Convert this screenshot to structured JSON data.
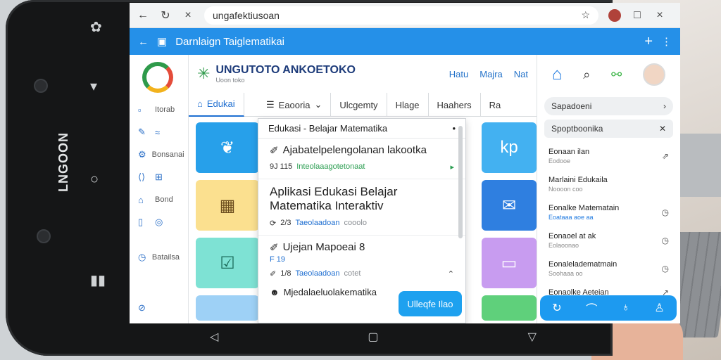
{
  "device": {
    "brand": "LNGOON",
    "side_icons": [
      "settings-icon",
      "message-icon",
      "home-circle-icon",
      "recents-icon"
    ],
    "nav_icons": [
      "back-triangle-icon",
      "home-square-icon",
      "down-chevron-icon"
    ]
  },
  "browser": {
    "url": "ungafektiusoan",
    "back": "←",
    "reload": "↻",
    "close_tab": "×",
    "window_minimize": "□",
    "window_close": "×"
  },
  "appbar": {
    "title": "Darnlaign Taiglematikai",
    "back": "←",
    "plus": "+",
    "more": "⋮"
  },
  "sidebar": {
    "items": [
      {
        "label": "Itorab",
        "icon": "square-icon"
      },
      {
        "label": "",
        "icon": "pencil-icon"
      },
      {
        "label": "Bonsanai",
        "icon": "gear-icon"
      },
      {
        "label": "",
        "icon": "code-icon"
      },
      {
        "label": "Bond",
        "icon": "tag-icon"
      },
      {
        "label": "",
        "icon": "doc-icon"
      },
      {
        "label": "Batailsa",
        "icon": "clock-icon"
      },
      {
        "label": "",
        "icon": "compass-icon"
      }
    ]
  },
  "header": {
    "brand": "UNGUTOTO ANKOETOKO",
    "subtitle": "Uoon toko",
    "links": [
      "Hatu",
      "Majra",
      "Nat"
    ]
  },
  "tabs": [
    {
      "label": "Edukai",
      "active": true
    },
    {
      "label": "Eaooria",
      "active": false
    },
    {
      "label": "Ulcgemty",
      "active": false
    },
    {
      "label": "Hlage",
      "active": false
    },
    {
      "label": "Haahers",
      "active": false
    },
    {
      "label": "Ra",
      "active": false
    }
  ],
  "dropdown": {
    "header": "Edukasi - Belajar Matematika",
    "items": [
      {
        "title": "Ajabatelpelengolanan lakootka",
        "meta_a": "9J 115",
        "meta_b": "Inteolaaagotetonaat",
        "meta_c": ""
      },
      {
        "title": "Aplikasi Edukasi Belajar Matematika Interaktiv",
        "meta_a": "2/3",
        "meta_b": "Taeolaadoan",
        "meta_c": "cooolo"
      },
      {
        "title": "Ujejan Mapoeai 8",
        "meta_a": "F 19",
        "meta_b": "",
        "meta_c": ""
      },
      {
        "title": "",
        "meta_a": "1/8",
        "meta_b": "Taeolaadoan",
        "meta_c": "cotet"
      },
      {
        "title": "Mjedalaeluolakematika",
        "meta_a": "",
        "meta_b": "",
        "meta_c": ""
      }
    ],
    "fab": "Ulleqfe Ilao"
  },
  "panel": {
    "pill1": "Sapadoeni",
    "pill2": "Spoptboonika",
    "items": [
      {
        "title": "Eonaan ilan",
        "sub": "Eodooe",
        "icon": "→"
      },
      {
        "title": "Marlaini Edukaila",
        "sub": "Noooon coo",
        "icon": ""
      },
      {
        "title": "Eonalke Matematain",
        "sub": "Eoataaa aoe aa",
        "icon": "○"
      },
      {
        "title": "Eonaoel at ak",
        "sub": "Eolaoonao",
        "icon": "○"
      },
      {
        "title": "Eonaleladematmain",
        "sub": "Soohaaa oo",
        "icon": "○"
      },
      {
        "title": "Eonaolke Aeteian",
        "sub": "",
        "icon": "↗"
      }
    ]
  },
  "colors": {
    "appbar": "#2590e8",
    "accent": "#1f6fd1",
    "fab": "#1ea1ef"
  }
}
